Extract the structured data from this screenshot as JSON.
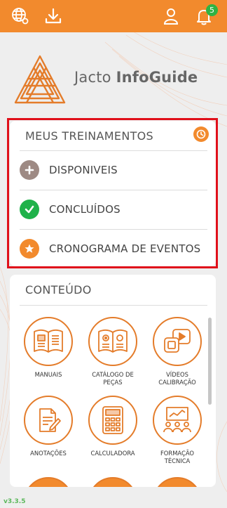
{
  "topbar": {
    "notification_count": "5",
    "icons": [
      "globe-settings-icon",
      "download-icon",
      "user-icon",
      "bell-icon"
    ]
  },
  "brand": {
    "name_light": "Jacto ",
    "name_bold": "InfoGuide"
  },
  "trainings": {
    "title": "MEUS TREINAMENTOS",
    "items": [
      {
        "label": "DISPONIVEIS",
        "icon": "plus-circle-icon",
        "color": "#9e8a84"
      },
      {
        "label": "CONCLUÍDOS",
        "icon": "check-circle-icon",
        "color": "#1fb24a"
      },
      {
        "label": "CRONOGRAMA DE EVENTOS",
        "icon": "star-circle-icon",
        "color": "#f28a2d"
      }
    ]
  },
  "content": {
    "title": "CONTEÚDO",
    "items": [
      {
        "label": "MANUAIS",
        "icon": "open-book-icon"
      },
      {
        "label": "CATÁLOGO DE\nPEÇAS",
        "icon": "parts-catalog-icon"
      },
      {
        "label": "VÍDEOS\nCALIBRAÇÃO",
        "icon": "video-icon"
      },
      {
        "label": "ANOTAÇÕES",
        "icon": "notes-icon"
      },
      {
        "label": "CALCULADORA",
        "icon": "calculator-icon"
      },
      {
        "label": "FORMAÇÃO\nTÉCNICA",
        "icon": "training-presentation-icon"
      }
    ]
  },
  "version": "v3.3.5",
  "colors": {
    "accent": "#f28a2d",
    "highlight_border": "#e0101a",
    "version": "#5cb85c"
  }
}
